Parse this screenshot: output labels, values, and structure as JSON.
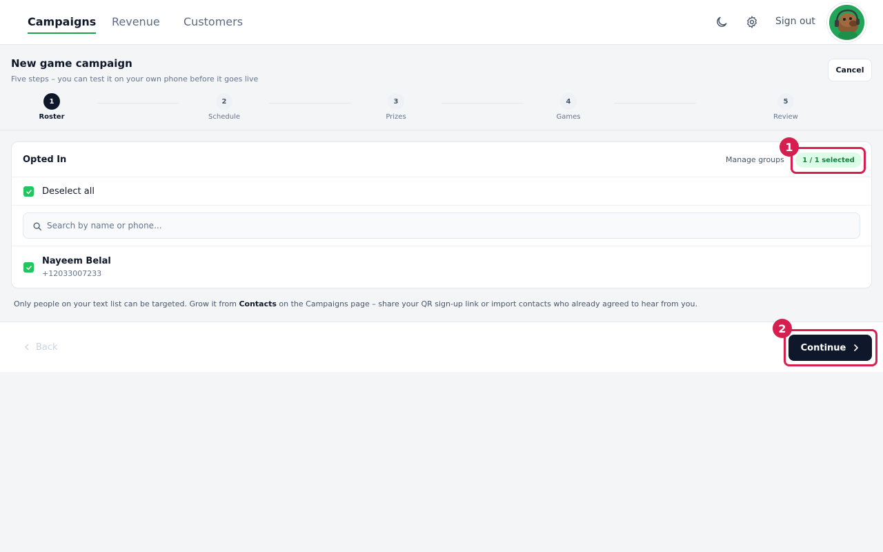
{
  "nav": {
    "tabs": [
      {
        "label": "Campaigns",
        "active": true
      },
      {
        "label": "Revenue",
        "active": false
      },
      {
        "label": "Customers",
        "active": false
      }
    ],
    "theme_icon": "moon-icon",
    "settings_icon": "gear-icon",
    "sign_out_label": "Sign out"
  },
  "header": {
    "title": "New game campaign",
    "subtitle": "Five steps – you can test it on your own phone before it goes live",
    "cancel_label": "Cancel"
  },
  "steps": [
    {
      "number": "1",
      "label": "Roster",
      "active": true
    },
    {
      "number": "2",
      "label": "Schedule",
      "active": false
    },
    {
      "number": "3",
      "label": "Prizes",
      "active": false
    },
    {
      "number": "4",
      "label": "Games",
      "active": false
    },
    {
      "number": "5",
      "label": "Review",
      "active": false
    }
  ],
  "roster": {
    "title": "Opted In",
    "manage_groups_label": "Manage groups",
    "selected_badge": "1 / 1 selected",
    "deselect_all_label": "Deselect all",
    "search_placeholder": "Search by name or phone...",
    "contacts": [
      {
        "name": "Nayeem Belal",
        "phone": "+12033007233",
        "checked": true
      }
    ]
  },
  "info": {
    "before": "Only people on your text list can be targeted. Grow it from ",
    "link": "Contacts",
    "after": " on the Campaigns page – share your QR sign-up link or import contacts who already agreed to hear from you."
  },
  "footer": {
    "back_label": "Back",
    "continue_label": "Continue"
  },
  "annotations": [
    {
      "number": "1"
    },
    {
      "number": "2"
    }
  ],
  "colors": {
    "accent_green": "#22c55e",
    "primary_dark": "#0f172a",
    "annotation_red": "#d61f4f"
  }
}
